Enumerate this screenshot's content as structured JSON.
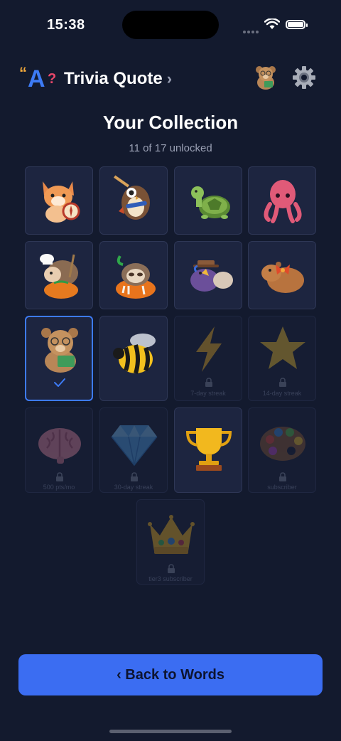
{
  "status_bar": {
    "time": "15:38"
  },
  "header": {
    "logo_letter": "A",
    "logo_quote": "“",
    "logo_question": "?",
    "app_title": "Trivia Quote",
    "chevron": "›"
  },
  "page": {
    "title": "Your Collection",
    "subtitle": "11 of 17 unlocked"
  },
  "collection": [
    {
      "name": "fox-explorer",
      "locked": false
    },
    {
      "name": "owl-scarf",
      "locked": false
    },
    {
      "name": "turtle",
      "locked": false
    },
    {
      "name": "octopus",
      "locked": false
    },
    {
      "name": "hedgehog-chef-pumpkin",
      "locked": false
    },
    {
      "name": "sloth-pumpkin",
      "locked": false
    },
    {
      "name": "purple-bird-hat",
      "locked": false
    },
    {
      "name": "capybara-bow",
      "locked": false
    },
    {
      "name": "bear-reading",
      "locked": false,
      "selected": true
    },
    {
      "name": "bee",
      "locked": false
    },
    {
      "name": "lightning",
      "locked": true,
      "requirement": "7-day streak"
    },
    {
      "name": "star",
      "locked": true,
      "requirement": "14-day streak"
    },
    {
      "name": "brain",
      "locked": true,
      "requirement": "500 pts/mo"
    },
    {
      "name": "diamond",
      "locked": true,
      "requirement": "30-day streak"
    },
    {
      "name": "trophy",
      "locked": false
    },
    {
      "name": "palette",
      "locked": true,
      "requirement": "subscriber"
    },
    {
      "name": "crown",
      "locked": true,
      "requirement": "tier3 subscriber"
    }
  ],
  "footer": {
    "back_label": "‹ Back to Words"
  },
  "colors": {
    "accent": "#3b6df2",
    "background": "#131a2e",
    "tile": "#1d2540",
    "selected_border": "#3d7bf5"
  }
}
